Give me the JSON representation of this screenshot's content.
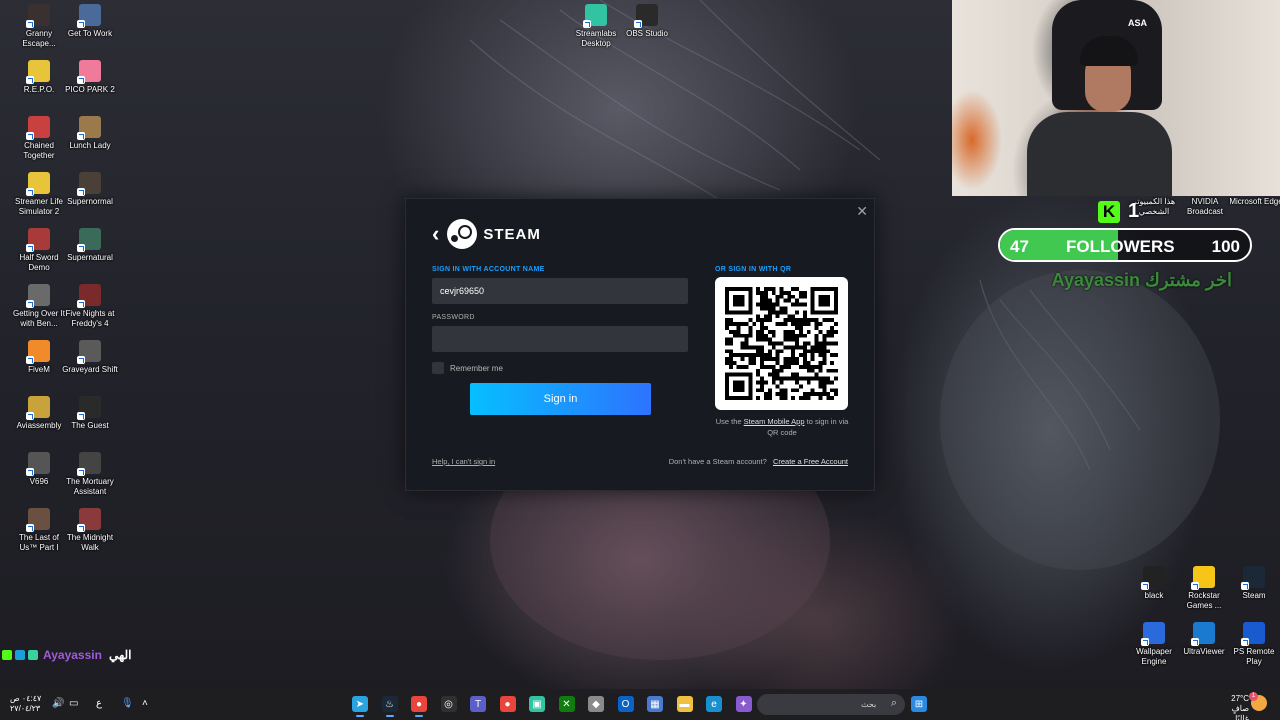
{
  "desktop": {
    "left_icons": [
      {
        "label": "Granny Escape...",
        "color": "#3a3030"
      },
      {
        "label": "Get To Work",
        "color": "#4a6a9a"
      },
      {
        "label": "R.E.P.O.",
        "color": "#e8c43a"
      },
      {
        "label": "PICO PARK 2",
        "color": "#f07a9a"
      },
      {
        "label": "Chained Together",
        "color": "#c94040"
      },
      {
        "label": "Lunch Lady",
        "color": "#9a7a4a"
      },
      {
        "label": "Streamer Life Simulator 2",
        "color": "#e8c43a"
      },
      {
        "label": "Supernormal",
        "color": "#4a4038"
      },
      {
        "label": "Half Sword Demo",
        "color": "#a83a3a"
      },
      {
        "label": "Supernatural",
        "color": "#3a6a5a"
      },
      {
        "label": "Getting Over It with Ben...",
        "color": "#6a6a6a"
      },
      {
        "label": "Five Nights at Freddy's 4",
        "color": "#7a2a2a"
      },
      {
        "label": "FiveM",
        "color": "#f08a2a"
      },
      {
        "label": "Graveyard Shift",
        "color": "#5a5a5a"
      },
      {
        "label": "Aviassembly",
        "color": "#c8a23a"
      },
      {
        "label": "The Guest",
        "color": "#2a2a2a"
      },
      {
        "label": "V696",
        "color": "#555555"
      },
      {
        "label": "The Mortuary Assistant",
        "color": "#444444"
      },
      {
        "label": "The Last of Us™ Part I",
        "color": "#6a5040"
      },
      {
        "label": "The Midnight Walk",
        "color": "#8a3a3a"
      }
    ],
    "top_icons": [
      {
        "label": "Streamlabs Desktop",
        "color": "#31c3a2"
      },
      {
        "label": "OBS Studio",
        "color": "#2a2a2a"
      }
    ],
    "right_top_icons": [
      {
        "label": "هذا الكمبيوتر الشخصي",
        "color": "#3a6aa0"
      },
      {
        "label": "NVIDIA Broadcast",
        "color": "#76b900"
      },
      {
        "label": "Microsoft Edge",
        "color": "#1a8fd0"
      }
    ],
    "right_bottom_icons": [
      {
        "label": "black",
        "color": "#222222"
      },
      {
        "label": "Rockstar Games ...",
        "color": "#f5c518"
      },
      {
        "label": "Steam",
        "color": "#1b2838"
      },
      {
        "label": "Wallpaper Engine",
        "color": "#2a6adc"
      },
      {
        "label": "UltraViewer",
        "color": "#1a7ad0"
      },
      {
        "label": "PS Remote Play",
        "color": "#1a5ad0"
      }
    ]
  },
  "webcam": {
    "chair_label": "ASA"
  },
  "followers_widget": {
    "kick_badge": "K",
    "kick_count": "1",
    "current": "47",
    "label": "FOLLOWERS",
    "goal": "100",
    "progress_fraction": 0.47,
    "latest": "Ayayassin اخر مشترك",
    "fill_color": "#40c850"
  },
  "steam_dialog": {
    "wordmark": "STEAM",
    "account_section_label": "SIGN IN WITH ACCOUNT NAME",
    "account_value": "cevjr69650",
    "password_label": "PASSWORD",
    "password_value": "",
    "remember_label": "Remember me",
    "sign_in_label": "Sign in",
    "qr_section_label": "OR SIGN IN WITH QR",
    "qr_caption_pre": "Use the",
    "qr_caption_link": "Steam Mobile App",
    "qr_caption_post": "to sign in via QR code",
    "help_link": "Help, I can't sign in",
    "no_account_text": "Don't have a Steam account?",
    "create_account_link": "Create a Free Account"
  },
  "chat": {
    "user": "Ayayassin",
    "message": "الهي",
    "badge_colors": [
      "#53fc18",
      "#1a9fd8",
      "#3ad0a0"
    ]
  },
  "taskbar": {
    "time": "٠٤:٤٧ ص",
    "date": "٢٧/٠٤/٢٣",
    "lang": "ع",
    "search_label": "بحث",
    "weather_temp": "27°C",
    "weather_desc": "صافٍ غالبًا",
    "notification_count": "1",
    "apps": [
      {
        "name": "telegram-icon",
        "color": "#2aa3e0",
        "glyph": "➤"
      },
      {
        "name": "steam-icon",
        "color": "#1b2838",
        "glyph": "♨"
      },
      {
        "name": "chrome-icon",
        "color": "#e8453c",
        "glyph": "●"
      },
      {
        "name": "obs-icon",
        "color": "#303030",
        "glyph": "◎"
      },
      {
        "name": "teams-icon",
        "color": "#5b5fc7",
        "glyph": "T"
      },
      {
        "name": "chrome-icon-2",
        "color": "#e8453c",
        "glyph": "●"
      },
      {
        "name": "streamlabs-icon",
        "color": "#31c3a2",
        "glyph": "▣"
      },
      {
        "name": "xbox-icon",
        "color": "#107c10",
        "glyph": "✕"
      },
      {
        "name": "cube-icon",
        "color": "#8a8a8a",
        "glyph": "◆"
      },
      {
        "name": "outlook-icon",
        "color": "#0a64c8",
        "glyph": "O"
      },
      {
        "name": "store-icon",
        "color": "#4a7ad0",
        "glyph": "▦"
      },
      {
        "name": "folder-icon",
        "color": "#f0c040",
        "glyph": "▬"
      },
      {
        "name": "edge-icon",
        "color": "#1a8fd0",
        "glyph": "e"
      },
      {
        "name": "copilot-icon",
        "color": "#8a5ad0",
        "glyph": "✦"
      }
    ]
  }
}
